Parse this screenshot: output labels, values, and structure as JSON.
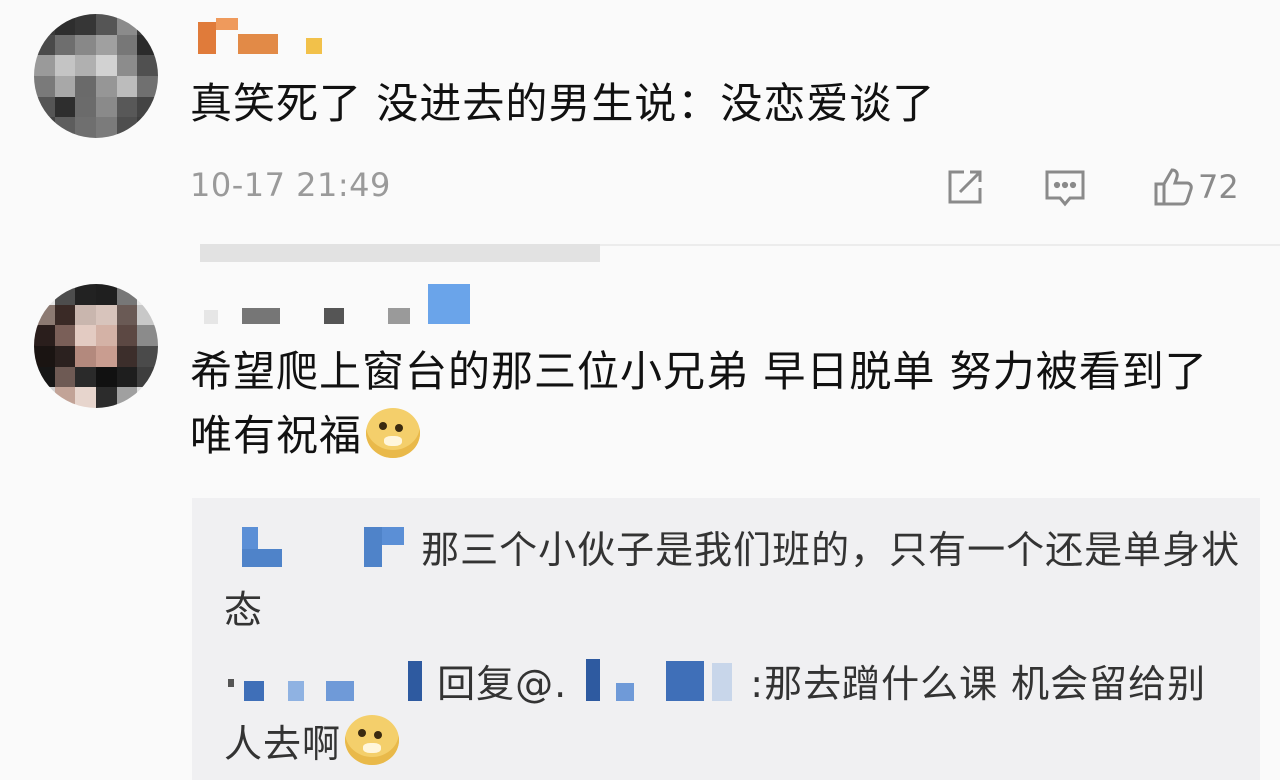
{
  "comments": [
    {
      "text": "真笑死了 没进去的男生说：没恋爱谈了",
      "time": "10-17 21:49",
      "likes": "72",
      "icons": [
        "share-icon",
        "comment-icon",
        "like-icon"
      ]
    },
    {
      "text": "希望爬上窗台的那三位小兄弟 早日脱单 努力被看到了 唯有祝福",
      "emoji": "doge-emoji",
      "replies": [
        {
          "text": "那三个小伙子是我们班的，只有一个还是单身状态"
        },
        {
          "reply_word": "回复",
          "at": "@.",
          "text": ":那去蹭什么课 机会留给别人去啊",
          "emoji": "doge-emoji"
        }
      ]
    }
  ],
  "colors": {
    "background": "#fafafa",
    "reply_background": "#f0f0f2",
    "meta_gray": "#9a9a9a",
    "icon_gray": "#8a8a8a",
    "mosaic_blue": "#5b8fd6",
    "mosaic_orange": "#e07b3a"
  }
}
